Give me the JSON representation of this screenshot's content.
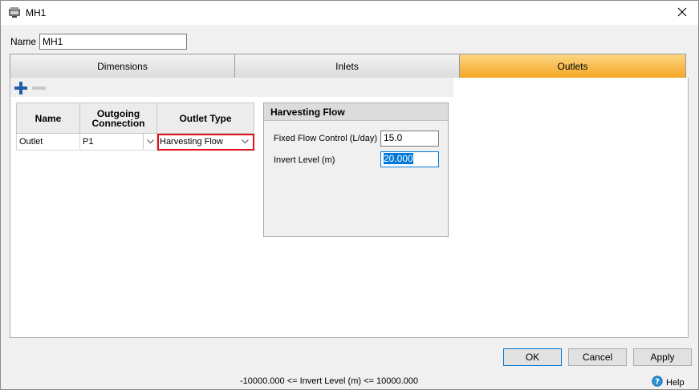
{
  "window": {
    "title": "MH1",
    "icons": {
      "app": "manhole-app-icon",
      "close": "close-icon"
    }
  },
  "name_field": {
    "label": "Name",
    "value": "MH1"
  },
  "tabs": [
    {
      "label": "Dimensions",
      "active": false
    },
    {
      "label": "Inlets",
      "active": false
    },
    {
      "label": "Outlets",
      "active": true
    }
  ],
  "toolbar": {
    "add_icon": "plus-icon",
    "remove_icon": "minus-icon"
  },
  "outlets_table": {
    "headers": [
      "Name",
      "Outgoing Connection",
      "Outlet Type"
    ],
    "rows": [
      {
        "name": "Outlet",
        "connection": "P1",
        "type": "Harvesting Flow"
      }
    ]
  },
  "harvesting_panel": {
    "title": "Harvesting Flow",
    "fixed_flow_label": "Fixed Flow Control (L/day)",
    "fixed_flow_value": "15.0",
    "invert_level_label": "Invert Level (m)",
    "invert_level_value": "20.000"
  },
  "buttons": {
    "ok": "OK",
    "cancel": "Cancel",
    "apply": "Apply"
  },
  "status": {
    "validation_text": "-10000.000 <= Invert Level (m) <= 10000.000",
    "help_label": "Help"
  },
  "colors": {
    "active_tab_top": "#fcd784",
    "active_tab_bottom": "#f5a623",
    "selection": "#0078d7",
    "error_outline": "#e0141e",
    "add_icon": "#1e5fa8"
  }
}
